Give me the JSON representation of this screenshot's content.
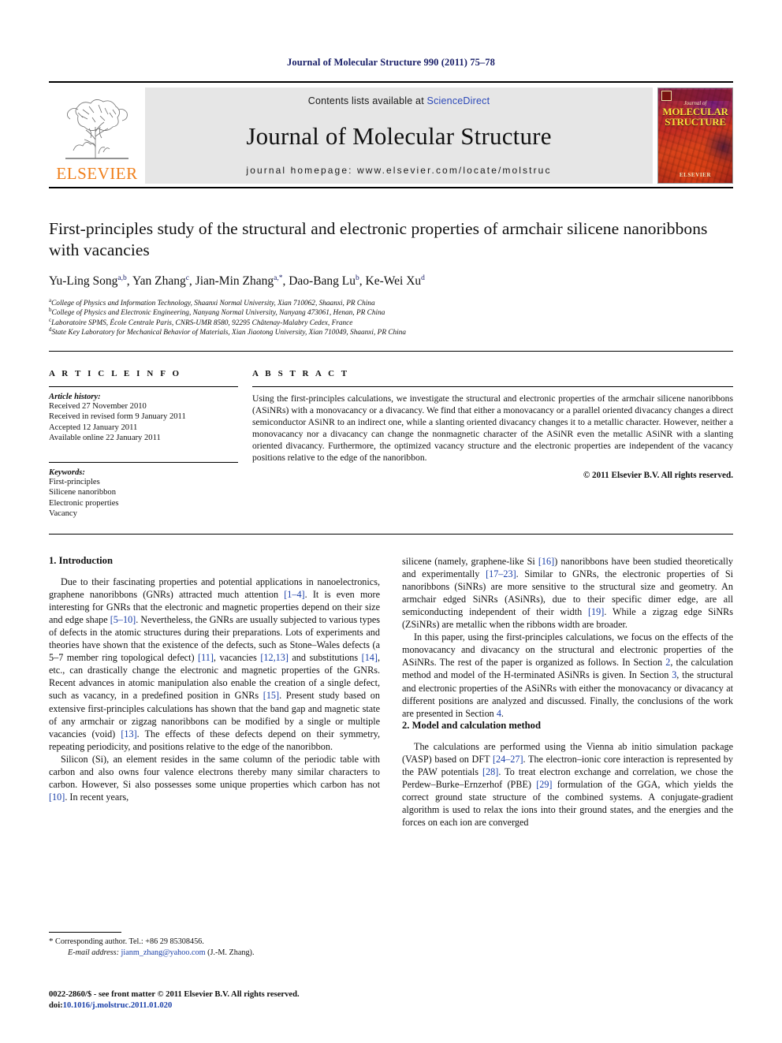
{
  "running_head": "Journal of Molecular Structure 990 (2011) 75–78",
  "masthead": {
    "publisher_word": "ELSEVIER",
    "contents_prefix": "Contents lists available at ",
    "contents_link": "ScienceDirect",
    "journal_title": "Journal of Molecular Structure",
    "homepage": "journal homepage: www.elsevier.com/locate/molstruc",
    "cover": {
      "journal_of": "Journal of",
      "name_line1": "MOLECULAR",
      "name_line2": "STRUCTURE",
      "bottom_word": "ELSEVIER"
    }
  },
  "article": {
    "title": "First-principles study of the structural and electronic properties of armchair silicene nanoribbons with vacancies",
    "authors": [
      {
        "name": "Yu-Ling Song",
        "sup": "a,b",
        "sep": ", "
      },
      {
        "name": "Yan Zhang",
        "sup": "c",
        "sep": ", "
      },
      {
        "name": "Jian-Min Zhang",
        "sup": "a,*",
        "sep": ", "
      },
      {
        "name": "Dao-Bang Lu",
        "sup": "b",
        "sep": ", "
      },
      {
        "name": "Ke-Wei Xu",
        "sup": "d",
        "sep": ""
      }
    ],
    "affiliations": [
      {
        "mark": "a",
        "text": "College of Physics and Information Technology, Shaanxi Normal University, Xian 710062, Shaanxi, PR China"
      },
      {
        "mark": "b",
        "text": "College of Physics and Electronic Engineering, Nanyang Normal University, Nanyang 473061, Henan, PR China"
      },
      {
        "mark": "c",
        "text": "Laboratoire SPMS, École Centrale Paris, CNRS-UMR 8580, 92295 Châtenay-Malabry Cedex, France"
      },
      {
        "mark": "d",
        "text": "State Key Laboratory for Mechanical Behavior of Materials, Xian Jiaotong University, Xian 710049, Shaanxi, PR China"
      }
    ]
  },
  "article_info": {
    "heading": "A R T I C L E  I N F O",
    "history_label": "Article history:",
    "history": [
      "Received 27 November 2010",
      "Received in revised form 9 January 2011",
      "Accepted 12 January 2011",
      "Available online 22 January 2011"
    ],
    "keywords_label": "Keywords:",
    "keywords": [
      "First-principles",
      "Silicene nanoribbon",
      "Electronic properties",
      "Vacancy"
    ]
  },
  "abstract": {
    "heading": "A B S T R A C T",
    "text": "Using the first-principles calculations, we investigate the structural and electronic properties of the armchair silicene nanoribbons (ASiNRs) with a monovacancy or a divacancy. We find that either a monovacancy or a parallel oriented divacancy changes a direct semiconductor ASiNR to an indirect one, while a slanting oriented divacancy changes it to a metallic character. However, neither a monovacancy nor a divacancy can change the nonmagnetic character of the ASiNR even the metallic ASiNR with a slanting oriented divacancy. Furthermore, the optimized vacancy structure and the electronic properties are independent of the vacancy positions relative to the edge of the nanoribbon.",
    "copyright": "© 2011 Elsevier B.V. All rights reserved."
  },
  "sections": {
    "intro_heading": "1. Introduction",
    "intro_p1_a": "Due to their fascinating properties and potential applications in nanoelectronics, graphene nanoribbons (GNRs) attracted much attention ",
    "intro_p1_r1": "[1–4]",
    "intro_p1_b": ". It is even more interesting for GNRs that the electronic and magnetic properties depend on their size and edge shape ",
    "intro_p1_r2": "[5–10]",
    "intro_p1_c": ". Nevertheless, the GNRs are usually subjected to various types of defects in the atomic structures during their preparations. Lots of experiments and theories have shown that the existence of the defects, such as Stone–Wales defects (a 5–7 member ring topological defect) ",
    "intro_p1_r3": "[11]",
    "intro_p1_d": ", vacancies ",
    "intro_p1_r4": "[12,13]",
    "intro_p1_e": " and substitutions ",
    "intro_p1_r5": "[14]",
    "intro_p1_f": ", etc., can drastically change the electronic and magnetic properties of the GNRs. Recent advances in atomic manipulation also enable the creation of a single defect, such as vacancy, in a predefined position in GNRs ",
    "intro_p1_r6": "[15]",
    "intro_p1_g": ". Present study based on extensive first-principles calculations has shown that the band gap and magnetic state of any armchair or zigzag nanoribbons can be modified by a single or multiple vacancies (void) ",
    "intro_p1_r7": "[13]",
    "intro_p1_h": ". The effects of these defects depend on their symmetry, repeating periodicity, and positions relative to the edge of the nanoribbon.",
    "intro_p2_a": "Silicon (Si), an element resides in the same column of the periodic table with carbon and also owns four valence electrons thereby many similar characters to carbon. However, Si also possesses some unique properties which carbon has not ",
    "intro_p2_r1": "[10]",
    "intro_p2_b": ". In recent years,",
    "right_p1_a": "silicene (namely, graphene-like Si ",
    "right_p1_r1": "[16]",
    "right_p1_b": ") nanoribbons have been studied theoretically and experimentally ",
    "right_p1_r2": "[17–23]",
    "right_p1_c": ". Similar to GNRs, the electronic properties of Si nanoribbons (SiNRs) are more sensitive to the structural size and geometry. An armchair edged SiNRs (ASiNRs), due to their specific dimer edge, are all semiconducting independent of their width ",
    "right_p1_r3": "[19]",
    "right_p1_d": ". While a zigzag edge SiNRs (ZSiNRs) are metallic when the ribbons width are broader.",
    "right_p2_a": "In this paper, using the first-principles calculations, we focus on the effects of the monovacancy and divacancy on the structural and electronic properties of the ASiNRs. The rest of the paper is organized as follows. In Section ",
    "right_p2_r1": "2",
    "right_p2_b": ", the calculation method and model of the H-terminated ASiNRs is given. In Section ",
    "right_p2_r2": "3",
    "right_p2_c": ", the structural and electronic properties of the ASiNRs with either the monovacancy or divacancy at different positions are analyzed and discussed. Finally, the conclusions of the work are presented in Section ",
    "right_p2_r3": "4",
    "right_p2_d": ".",
    "model_heading": "2. Model and calculation method",
    "model_p1_a": "The calculations are performed using the Vienna ab initio simulation package (VASP) based on DFT ",
    "model_p1_r1": "[24–27]",
    "model_p1_b": ". The electron–ionic core interaction is represented by the PAW potentials ",
    "model_p1_r2": "[28]",
    "model_p1_c": ". To treat electron exchange and correlation, we chose the Perdew–Burke–Ernzerhof (PBE) ",
    "model_p1_r3": "[29]",
    "model_p1_d": " formulation of the GGA, which yields the correct ground state structure of the combined systems. A conjugate-gradient algorithm is used to relax the ions into their ground states, and the energies and the forces on each ion are converged"
  },
  "footer": {
    "corresponding_star": "*",
    "corresponding": "Corresponding author. Tel.: +86 29 85308456.",
    "email_label": "E-mail address:",
    "email": "jianm_zhang@yahoo.com",
    "email_owner": "(J.-M. Zhang).",
    "issn_line": "0022-2860/$ - see front matter © 2011 Elsevier B.V. All rights reserved.",
    "doi_label": "doi:",
    "doi": "10.1016/j.molstruc.2011.01.020"
  },
  "colors": {
    "link_blue": "#1a3fa8",
    "header_blue": "#1a2069",
    "elsevier_orange": "#f07f1a",
    "masthead_gray": "#e6e6e6"
  }
}
